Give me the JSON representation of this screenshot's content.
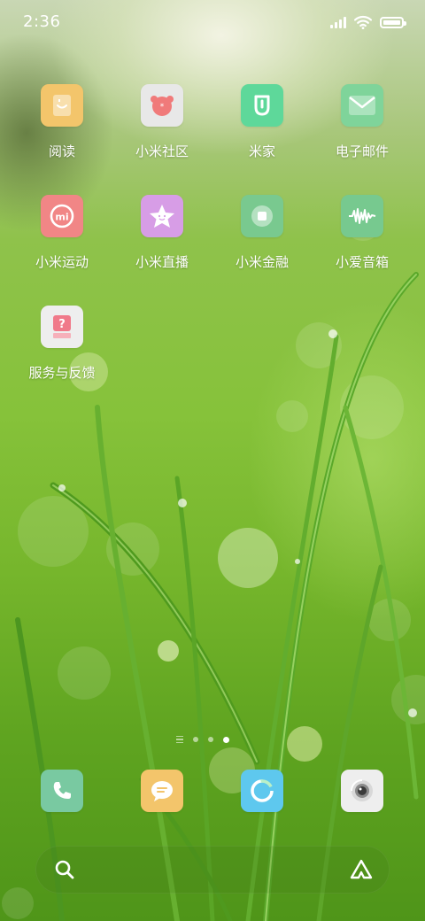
{
  "status_bar": {
    "time": "2:36",
    "signal_level": 4,
    "battery_level": 1.0
  },
  "apps": [
    {
      "label": "阅读",
      "icon": "reading-icon",
      "color": "#f3c56b"
    },
    {
      "label": "小米社区",
      "icon": "mi-community-icon",
      "color": "#e8e8e8"
    },
    {
      "label": "米家",
      "icon": "mijia-icon",
      "color": "#5ed89a"
    },
    {
      "label": "电子邮件",
      "icon": "mail-icon",
      "color": "#7fd49a"
    },
    {
      "label": "小米运动",
      "icon": "mi-fit-icon",
      "color": "#f18686"
    },
    {
      "label": "小米直播",
      "icon": "mi-live-icon",
      "color": "#d79de6"
    },
    {
      "label": "小米金融",
      "icon": "mi-finance-icon",
      "color": "#79c98f"
    },
    {
      "label": "小爱音箱",
      "icon": "xiaoai-speaker-icon",
      "color": "#77c98f"
    },
    {
      "label": "服务与反馈",
      "icon": "service-feedback-icon",
      "color": "#eeeeee"
    }
  ],
  "page_indicator": {
    "pages": 4,
    "active_page": 4
  },
  "dock": [
    {
      "icon": "phone-icon",
      "color": "#79c9a1"
    },
    {
      "icon": "messages-icon",
      "color": "#f3c56b"
    },
    {
      "icon": "browser-icon",
      "color": "#5ec8ee"
    },
    {
      "icon": "camera-icon",
      "color": "#eeeeee"
    }
  ],
  "search_bar": {
    "left_icon": "search-icon",
    "right_icon": "assistant-icon"
  }
}
